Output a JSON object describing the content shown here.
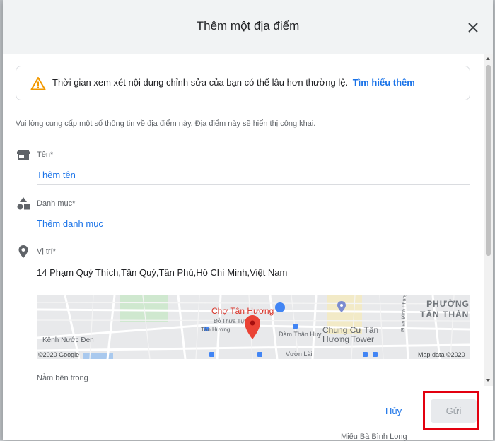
{
  "dialog": {
    "title": "Thêm một địa điểm",
    "notice": {
      "text": "Thời gian xem xét nội dung chỉnh sửa của bạn có thể lâu hơn thường lệ.",
      "link": "Tìm hiểu thêm"
    },
    "intro": "Vui lòng cung cấp một số thông tin về địa điểm này. Địa điểm này sẽ hiển thị công khai.",
    "fields": {
      "name": {
        "label": "Tên*",
        "placeholder": "Thêm tên",
        "icon": "storefront-icon"
      },
      "category": {
        "label": "Danh mục*",
        "placeholder": "Thêm danh mục",
        "icon": "shapes-icon"
      },
      "location": {
        "label": "Vị trí*",
        "value": "14 Phạm Quý Thích,Tân Quý,Tân Phú,Hồ Chí Minh,Việt Nam",
        "icon": "location-pin-icon"
      }
    },
    "map": {
      "district": [
        "PHƯỜNG",
        "TÂN THÀNH"
      ],
      "poi_market": "Chợ Tân Hương",
      "poi_apartment": [
        "Chung Cư Tân",
        "Hương Tower"
      ],
      "streets": [
        "Đỗ Thừa Tự",
        "Tân Hương",
        "Kênh Nước Đen",
        "Đàm Thận Huy",
        "Vườn Lài",
        "Phan Đình Phùng"
      ],
      "copyright_left": "©2020 Google",
      "copyright_right": "Map data ©2020"
    },
    "nearby_label": "Nằm bên trong",
    "buttons": {
      "cancel": "Hủy",
      "submit": "Gửi"
    }
  },
  "background_text": "Miếu Bà Bình Long",
  "colors": {
    "accent": "#1a73e8",
    "highlight": "#e3000f",
    "warning": "#f29900",
    "pin": "#ea4335"
  }
}
